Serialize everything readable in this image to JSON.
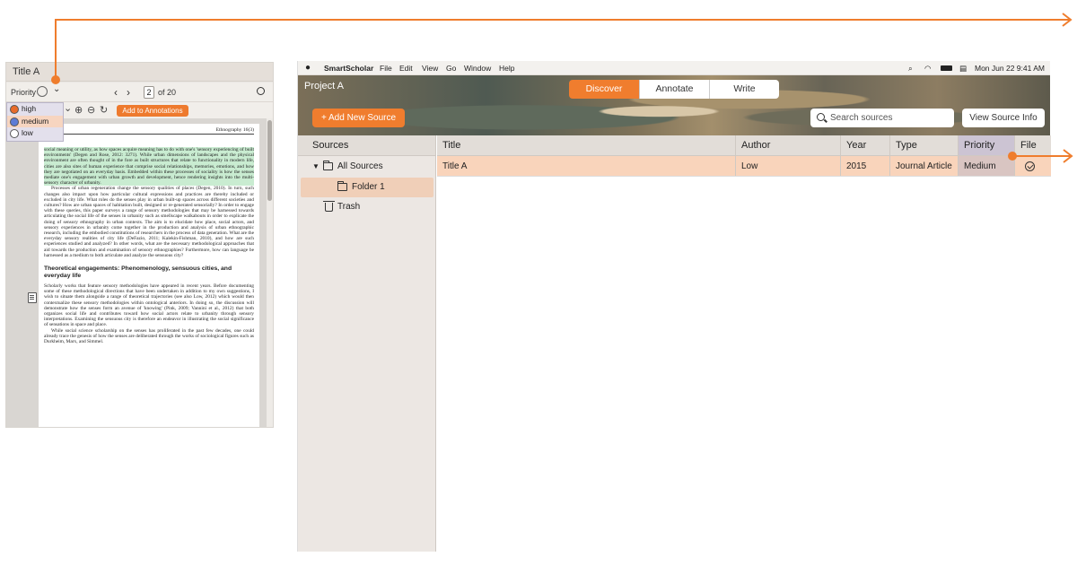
{
  "reader": {
    "title": "Title A",
    "priority_label": "Priority",
    "page_current": "2",
    "page_total_text": "of 20",
    "add_annotations_label": "Add to Annotations",
    "priority_options": [
      {
        "label": "high",
        "color": "#e86b2a"
      },
      {
        "label": "medium",
        "color": "#5b7bd6"
      },
      {
        "label": "low",
        "color": "#ffffff"
      }
    ],
    "selected_priority": "medium",
    "doc": {
      "journal_header": "Ethnography 16(3)",
      "para1_highlight": "social meaning or utility, as how spaces acquire meaning has to do with one's 'sensory experiencing of built environments' (Degen and Rose, 2012: 3271). While urban dimensions of landscapes and the physical environment are often thought of in the fore as built structures that relate to functionality in modern life, cities are also sites of human experience that comprise social relationships, memories, emotions, and how they are negotiated on an everyday basis. Embedded within these processes of sociality is how the senses mediate one's engagement with urban growth and development, hence rendering insights into the multi-sensory character of urbanity.",
      "para2": "Processes of urban regeneration change the sensory qualities of places (Degen, 2010). In turn, such changes also impact upon how particular cultural expressions and practices are thereby included or excluded in city life. What roles do the senses play in urban built-up spaces across different societies and cultures? How are urban spaces of habitation built, designed or re-generated sensorially? In order to engage with these queries, this paper surveys a range of sensory methodologies that may be harnessed towards articulating the social life of the senses in urbanity such as smellscape walkabouts in order to explicate the doing of sensory ethnography in urban contexts. The aim is to elucidate how place, social actors, and sensory experiences in urbanity come together in the production and analysis of urban ethnographic research, including the embodied constitutions of researchers in the process of data generation. What are the everyday sensory realities of city life (DeFazio, 2011; Kalekin-Fishman, 2010), and how are such experiences studied and analyzed? In other words, what are the necessary methodological approaches that aid towards the production and examination of sensory ethnographies? Furthermore, how can language be harnessed as a medium to both articulate and analyze the sensuous city?",
      "heading": "Theoretical engagements: Phenomenology, sensuous cities, and everyday life",
      "para3": "Scholarly works that feature sensory methodologies have appeared in recent years. Before documenting some of these methodological directions that have been undertaken in addition to my own suggestions, I wish to situate them alongside a range of theoretical trajectories (see also Low, 2012) which would then contextualize these sensory methodologies within ontological anteriors. In doing so, the discussion will demonstrate how the senses form an avenue of 'knowing' (Pink, 2009; Vannini et al., 2012) that both organizes social life and contributes toward how social actors relate to urbanity through sensory interpretations. Examining the sensuous city is therefore an endeavor in illustrating the social significance of sensations in space and place.",
      "para4": "While social science scholarship on the senses has proliferated in the past few decades, one could already trace the genesis of how the senses are deliberated through the works of sociological figures such as Durkheim, Marx, and Simmel."
    }
  },
  "menubar": {
    "app_name": "SmartScholar",
    "menus": [
      "File",
      "Edit",
      "View",
      "Go",
      "Window",
      "Help"
    ],
    "clock": "Mon Jun 22  9:41 AM"
  },
  "header": {
    "project_title": "Project A",
    "tabs": [
      "Discover",
      "Annotate",
      "Write"
    ],
    "active_tab": "Discover",
    "add_source_label": "+ Add New Source",
    "search_placeholder": "Search sources",
    "view_info_label": "View Source Info"
  },
  "sidebar": {
    "header": "Sources",
    "items": [
      {
        "label": "All Sources"
      },
      {
        "label": "Folder 1"
      },
      {
        "label": "Trash"
      }
    ]
  },
  "table": {
    "columns": [
      "Title",
      "Author",
      "Year",
      "Type",
      "Priority",
      "File"
    ],
    "rows": [
      {
        "title": "Title A",
        "author": "Low",
        "year": "2015",
        "type": "Journal Article",
        "priority": "Medium",
        "file": "check-circle-icon"
      }
    ]
  },
  "colors": {
    "accent": "#f07d2e",
    "selection": "#f9d4bb",
    "priority_column": "#ccc4d3"
  }
}
